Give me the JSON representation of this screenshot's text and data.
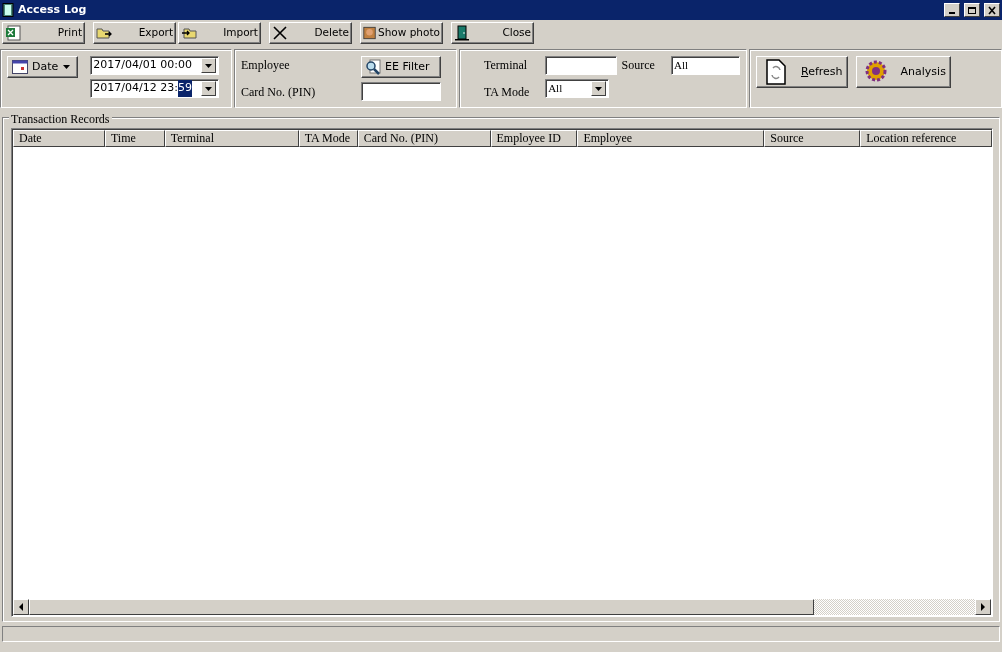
{
  "window": {
    "title": "Access Log"
  },
  "toolbar": [
    {
      "kind": "excel",
      "label": "Print"
    },
    {
      "kind": "export",
      "label": "Export"
    },
    {
      "kind": "import",
      "label": "Import"
    },
    {
      "kind": "delete",
      "label": "Delete"
    },
    {
      "kind": "photo",
      "label": "Show photo"
    },
    {
      "kind": "door",
      "label": "Close"
    }
  ],
  "date_filter": {
    "button": "Date",
    "from": {
      "value": "2017/04/01 00:00"
    },
    "to": {
      "value": "2017/04/12 23:",
      "highlighted": "59"
    }
  },
  "employee_filter": {
    "employee_label": "Employee",
    "filter_button": "EE Filter",
    "card_label": "Card No. (PIN)"
  },
  "terminal_filter": {
    "terminal_label": "Terminal",
    "source_label": "Source",
    "source_value": "All",
    "ta_mode_label": "TA Mode",
    "ta_mode_value": "All"
  },
  "actions": [
    {
      "kind": "refresh",
      "accel": "R",
      "label": "efresh"
    },
    {
      "kind": "analysis",
      "label": "Analysis"
    }
  ],
  "records": {
    "title": "Transaction Records",
    "columns": [
      "Date",
      "Time",
      "Terminal",
      "TA Mode",
      "Card No. (PIN)",
      "Employee ID",
      "Employee",
      "Source",
      "Location reference"
    ]
  }
}
